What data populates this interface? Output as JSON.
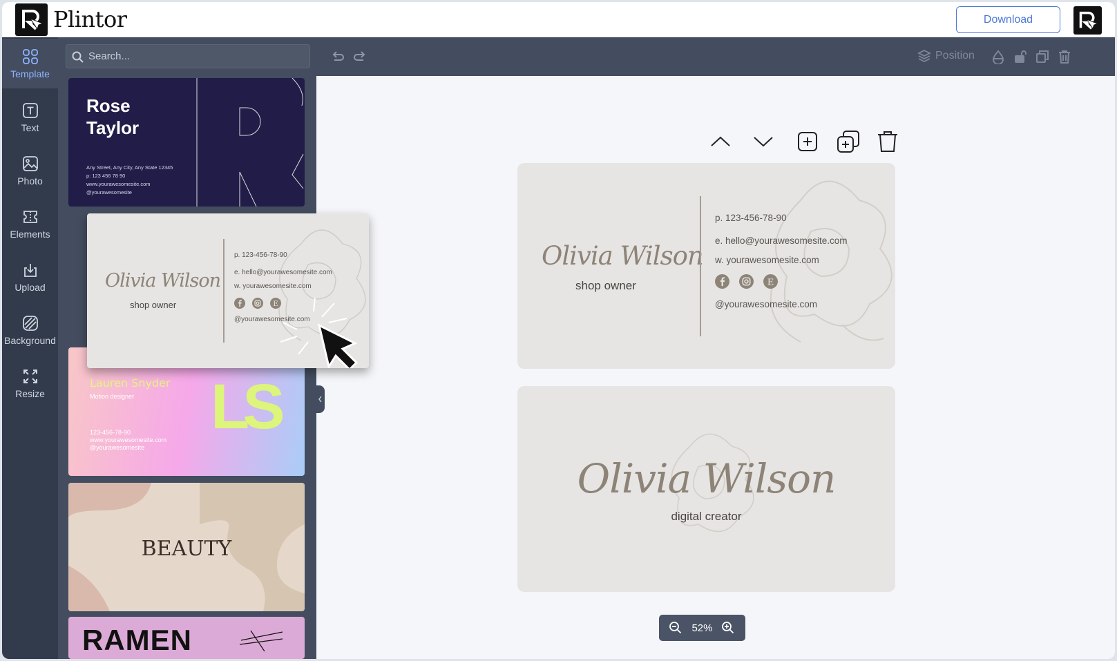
{
  "app": {
    "brand": "Plintor",
    "download_label": "Download"
  },
  "rail": [
    {
      "label": "Template",
      "icon": "grid-icon",
      "active": true
    },
    {
      "label": "Text",
      "icon": "text-icon"
    },
    {
      "label": "Photo",
      "icon": "image-icon"
    },
    {
      "label": "Elements",
      "icon": "elements-icon"
    },
    {
      "label": "Upload",
      "icon": "upload-icon"
    },
    {
      "label": "Background",
      "icon": "background-icon"
    },
    {
      "label": "Resize",
      "icon": "resize-icon"
    }
  ],
  "panel": {
    "search_placeholder": "Search...",
    "templates": {
      "rose": {
        "name": "Rose\nTaylor",
        "address": "Any Street, Any City, Any State 12345",
        "phone": "p: 123 456 78 90",
        "web": "www.yourawesomesite.com",
        "handle": "@yourawesomesite"
      },
      "olivia": {
        "name": "Olivia Wilson",
        "role": "shop owner",
        "phone": "p. 123-456-78-90",
        "email": "e. hello@yourawesomesite.com",
        "web": "w. yourawesomesite.com",
        "handle": "@yourawesomesite.com"
      },
      "lauren": {
        "name": "Lauren Snyder",
        "role": "Motion designer",
        "phone": "123-456-78-90",
        "web": "www.yourawesomesite.com",
        "handle": "@yourawesomesite",
        "monogram": "LS"
      },
      "beauty": {
        "title": "BEAUTY"
      },
      "ramen": {
        "title": "RAMEN"
      }
    }
  },
  "toolbar": {
    "position_label": "Position"
  },
  "canvas": {
    "front": {
      "name": "Olivia Wilson",
      "role": "shop owner",
      "phone": "p. 123-456-78-90",
      "email": "e. hello@yourawesomesite.com",
      "web": "w. yourawesomesite.com",
      "handle": "@yourawesomesite.com"
    },
    "back": {
      "name": "Olivia Wilson",
      "role": "digital creator"
    },
    "zoom": "52%"
  }
}
